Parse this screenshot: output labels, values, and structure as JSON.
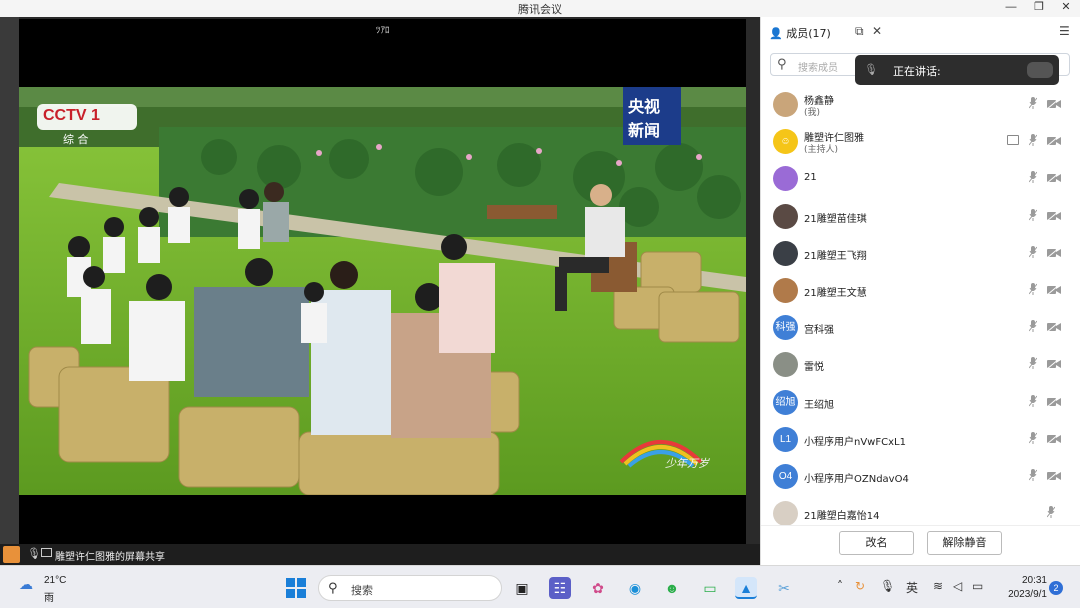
{
  "window": {
    "title": "腾讯会议",
    "min": "—",
    "max": "❐",
    "close": "✕"
  },
  "video": {
    "top_label": "ﾂｱﾛ",
    "channel_logo": "CCTV 1",
    "channel_sub": "综 合",
    "news_badge_1": "央视",
    "news_badge_2": "新闻",
    "watermark": "少年万岁",
    "share_bar_text": "雕塑许仁图雅的屏幕共享"
  },
  "panel": {
    "tab_label": "成员(17)",
    "search_placeholder": "搜索成员",
    "speaking_label": "正在讲话:",
    "members": [
      {
        "name": "杨鑫静",
        "sub": "(我)",
        "avatar_text": "",
        "avatar_color": "#c9a57a",
        "icons": [
          "mic",
          "cam"
        ]
      },
      {
        "name": "雕塑许仁图雅",
        "sub": "(主持人)",
        "avatar_text": "☺",
        "avatar_color": "#f5c518",
        "icons": [
          "share",
          "mic",
          "cam"
        ]
      },
      {
        "name": "21",
        "sub": "",
        "avatar_text": "",
        "avatar_color": "#9a6bd6",
        "icons": [
          "mic",
          "cam"
        ]
      },
      {
        "name": "21雕塑苗佳琪",
        "sub": "",
        "avatar_text": "",
        "avatar_color": "#5a4a44",
        "icons": [
          "mic",
          "cam"
        ]
      },
      {
        "name": "21雕塑王飞翔",
        "sub": "",
        "avatar_text": "",
        "avatar_color": "#3a3f46",
        "icons": [
          "mic",
          "cam"
        ]
      },
      {
        "name": "21雕塑王文慧",
        "sub": "",
        "avatar_text": "",
        "avatar_color": "#b07a4a",
        "icons": [
          "mic",
          "cam"
        ]
      },
      {
        "name": "宫科强",
        "sub": "",
        "avatar_text": "科强",
        "avatar_color": "#3f7fd6",
        "icons": [
          "mic",
          "cam"
        ]
      },
      {
        "name": "雷悦",
        "sub": "",
        "avatar_text": "",
        "avatar_color": "#8a8f86",
        "icons": [
          "mic",
          "cam"
        ]
      },
      {
        "name": "王绍旭",
        "sub": "",
        "avatar_text": "绍旭",
        "avatar_color": "#3f7fd6",
        "icons": [
          "mic",
          "cam"
        ]
      },
      {
        "name": "小程序用户nVwFCxL1",
        "sub": "",
        "avatar_text": "L1",
        "avatar_color": "#3f7fd6",
        "icons": [
          "mic",
          "cam"
        ]
      },
      {
        "name": "小程序用户OZNdavO4",
        "sub": "",
        "avatar_text": "O4",
        "avatar_color": "#3f7fd6",
        "icons": [
          "mic",
          "cam"
        ]
      },
      {
        "name": "21雕塑白嘉怡14",
        "sub": "",
        "avatar_text": "",
        "avatar_color": "#d8cfc4",
        "icons": [
          "mic"
        ]
      }
    ],
    "rename_button": "改名",
    "unmute_button": "解除静音"
  },
  "taskbar": {
    "temperature": "21°C",
    "condition": "雨",
    "search_label": "搜索",
    "ime": "英",
    "time": "20:31",
    "date": "2023/9/1",
    "notifications": "2"
  },
  "colors": {
    "accent": "#1a7fd8",
    "panel_bg": "#ffffff",
    "video_bg": "#000000"
  }
}
